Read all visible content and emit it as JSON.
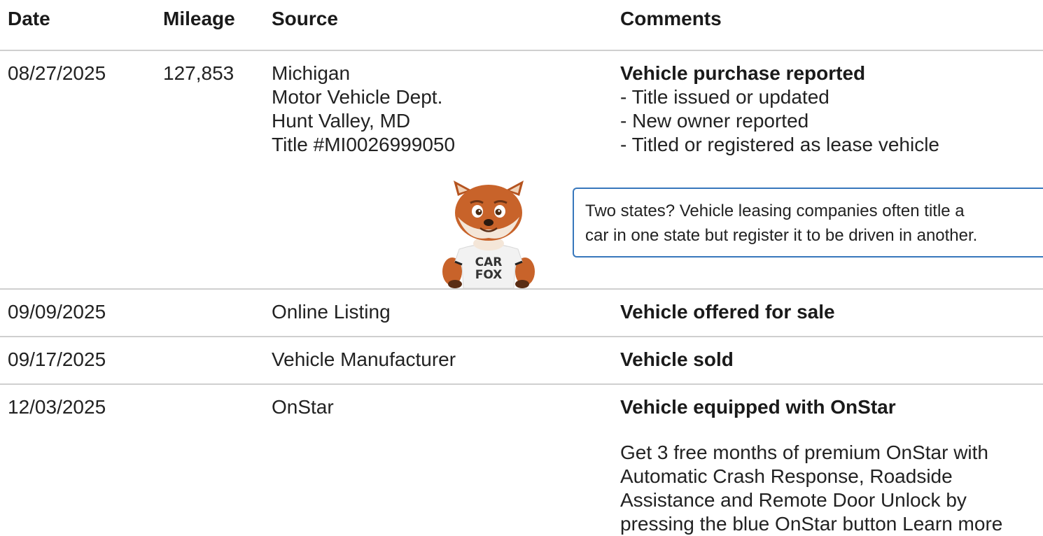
{
  "headers": {
    "date": "Date",
    "mileage": "Mileage",
    "source": "Source",
    "comments": "Comments"
  },
  "records": [
    {
      "date": "08/27/2025",
      "mileage": "127,853",
      "source": [
        "Michigan",
        "Motor Vehicle Dept.",
        "Hunt Valley, MD",
        "Title #MI0026999050"
      ],
      "comment_title": "Vehicle purchase reported",
      "comment_items": [
        "- Title issued or updated",
        "- New owner reported",
        "- Titled or registered as lease vehicle"
      ],
      "callout": [
        "Two states? Vehicle leasing companies often title a",
        "car in one state but register it to be driven in another."
      ]
    },
    {
      "date": "09/09/2025",
      "mileage": "",
      "source": [
        "Online Listing"
      ],
      "comment_title": "Vehicle offered for sale"
    },
    {
      "date": "09/17/2025",
      "mileage": "",
      "source": [
        "Vehicle Manufacturer"
      ],
      "comment_title": "Vehicle sold"
    },
    {
      "date": "12/03/2025",
      "mileage": "",
      "source": [
        "OnStar"
      ],
      "comment_title": "Vehicle equipped with OnStar",
      "promo_lines": [
        "Get 3 free months of premium OnStar with",
        "Automatic Crash Response, Roadside",
        "Assistance and Remote Door Unlock by",
        "pressing the blue OnStar button"
      ],
      "promo_link": "Learn more"
    }
  ],
  "mascot": {
    "shirt_line1": "CAR",
    "shirt_line2": "FOX"
  },
  "colors": {
    "callout_border": "#3777bc",
    "divider": "#cfcfcf",
    "fox_fur": "#c8632a",
    "shirt": "#f2f2f2"
  }
}
